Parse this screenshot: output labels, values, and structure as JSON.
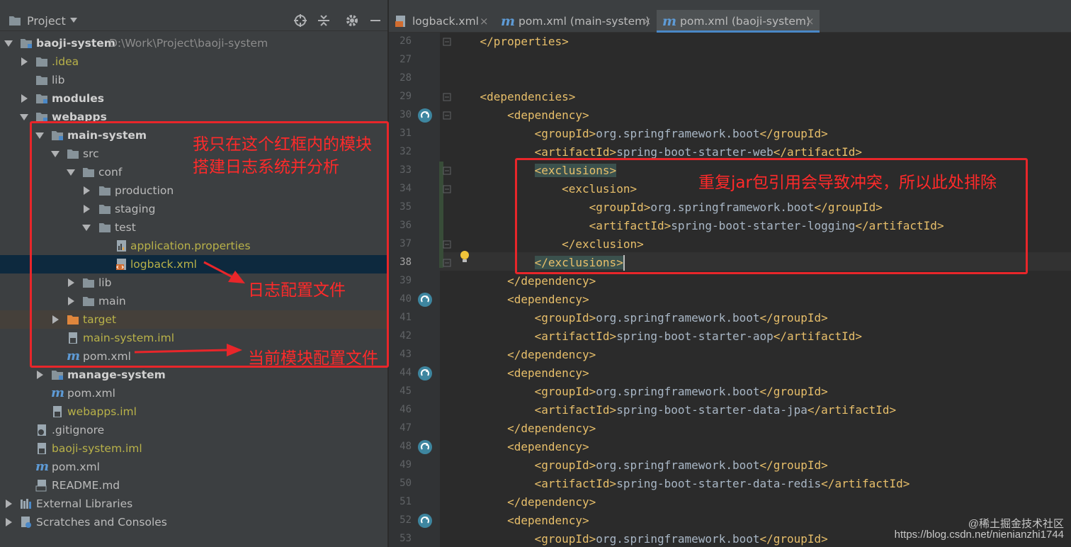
{
  "project_panel": {
    "title": "Project",
    "tree": [
      {
        "label": "baoji-system",
        "path": "D:\\Work\\Project\\baoji-system"
      },
      {
        "label": ".idea"
      },
      {
        "label": "lib"
      },
      {
        "label": "modules"
      },
      {
        "label": "webapps"
      },
      {
        "label": "main-system"
      },
      {
        "label": "src"
      },
      {
        "label": "conf"
      },
      {
        "label": "production"
      },
      {
        "label": "staging"
      },
      {
        "label": "test"
      },
      {
        "label": "application.properties"
      },
      {
        "label": "logback.xml"
      },
      {
        "label": "lib"
      },
      {
        "label": "main"
      },
      {
        "label": "target"
      },
      {
        "label": "main-system.iml"
      },
      {
        "label": "pom.xml"
      },
      {
        "label": "manage-system"
      },
      {
        "label": "pom.xml"
      },
      {
        "label": "webapps.iml"
      },
      {
        "label": ".gitignore"
      },
      {
        "label": "baoji-system.iml"
      },
      {
        "label": "pom.xml"
      },
      {
        "label": "README.md"
      },
      {
        "label": "External Libraries"
      },
      {
        "label": "Scratches and Consoles"
      }
    ]
  },
  "tabs": [
    {
      "label": "logback.xml",
      "close": "×"
    },
    {
      "label": "pom.xml (main-system)",
      "close": "×"
    },
    {
      "label": "pom.xml (baoji-system)",
      "close": "×"
    }
  ],
  "editor": {
    "lines": [
      {
        "n": "26",
        "code": "    </properties>"
      },
      {
        "n": "27",
        "code": ""
      },
      {
        "n": "28",
        "code": ""
      },
      {
        "n": "29",
        "code": "    <dependencies>"
      },
      {
        "n": "30",
        "code": "        <dependency>"
      },
      {
        "n": "31",
        "code": "            <groupId>org.springframework.boot</groupId>"
      },
      {
        "n": "32",
        "code": "            <artifactId>spring-boot-starter-web</artifactId>"
      },
      {
        "n": "33",
        "code": "            <exclusions>"
      },
      {
        "n": "34",
        "code": "                <exclusion>"
      },
      {
        "n": "35",
        "code": "                    <groupId>org.springframework.boot</groupId>"
      },
      {
        "n": "36",
        "code": "                    <artifactId>spring-boot-starter-logging</artifactId>"
      },
      {
        "n": "37",
        "code": "                </exclusion>"
      },
      {
        "n": "38",
        "code": "            </exclusions>"
      },
      {
        "n": "39",
        "code": "        </dependency>"
      },
      {
        "n": "40",
        "code": "        <dependency>"
      },
      {
        "n": "41",
        "code": "            <groupId>org.springframework.boot</groupId>"
      },
      {
        "n": "42",
        "code": "            <artifactId>spring-boot-starter-aop</artifactId>"
      },
      {
        "n": "43",
        "code": "        </dependency>"
      },
      {
        "n": "44",
        "code": "        <dependency>"
      },
      {
        "n": "45",
        "code": "            <groupId>org.springframework.boot</groupId>"
      },
      {
        "n": "46",
        "code": "            <artifactId>spring-boot-starter-data-jpa</artifactId>"
      },
      {
        "n": "47",
        "code": "        </dependency>"
      },
      {
        "n": "48",
        "code": "        <dependency>"
      },
      {
        "n": "49",
        "code": "            <groupId>org.springframework.boot</groupId>"
      },
      {
        "n": "50",
        "code": "            <artifactId>spring-boot-starter-data-redis</artifactId>"
      },
      {
        "n": "51",
        "code": "        </dependency>"
      },
      {
        "n": "52",
        "code": "        <dependency>"
      },
      {
        "n": "53",
        "code": "            <groupId>org.springframework.boot</groupId>"
      }
    ]
  },
  "annotations": {
    "module_note_line1": "我只在这个红框内的模块",
    "module_note_line2": "搭建日志系统并分析",
    "log_config_note": "日志配置文件",
    "module_config_note": "当前模块配置文件",
    "exclusion_note": "重复jar包引用会导致冲突，所以此处排除"
  },
  "watermark": {
    "line1": "@稀土掘金技术社区",
    "line2": "https://blog.csdn.net/nienianzhi1744"
  },
  "colors": {
    "annotation_red": "#e8262a",
    "xml_tag": "#e8bf6a",
    "xml_text": "#a9b7c6",
    "selection": "#0d293e"
  }
}
